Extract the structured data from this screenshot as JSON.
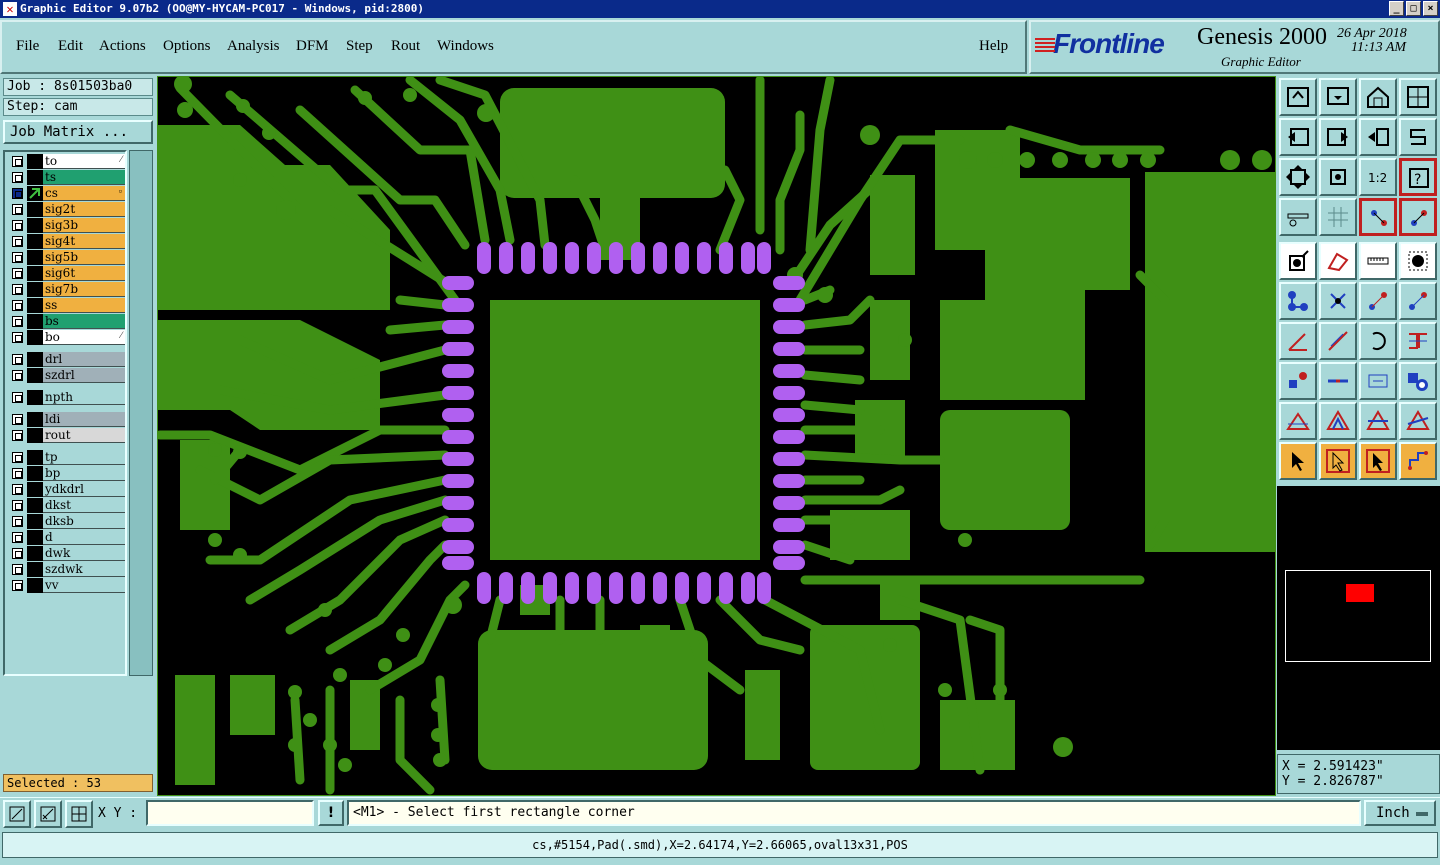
{
  "window": {
    "title": "Graphic Editor 9.07b2 (OO@MY-HYCAM-PC017 - Windows, pid:2800)",
    "controls": [
      "_",
      "□",
      "×"
    ]
  },
  "menu": {
    "items": [
      "File",
      "Edit",
      "Actions",
      "Options",
      "Analysis",
      "DFM",
      "Step",
      "Rout",
      "Windows"
    ],
    "help": "Help"
  },
  "brand": {
    "logo": "Frontline",
    "product": "Genesis 2000",
    "subtitle": "Graphic Editor",
    "date": "26 Apr 2018",
    "time": "11:13 AM"
  },
  "job": {
    "job_label": "Job : 8s01503ba0",
    "step_label": "Step: cam",
    "matrix_button": "Job Matrix ..."
  },
  "layers": [
    {
      "name": "to",
      "color": "#ffffff",
      "mark": "⁄"
    },
    {
      "name": "ts",
      "color": "#20a070",
      "mark": ""
    },
    {
      "name": "cs",
      "color": "#f0b040",
      "mark": "▫",
      "active": true
    },
    {
      "name": "sig2t",
      "color": "#f0b040",
      "mark": ""
    },
    {
      "name": "sig3b",
      "color": "#f0b040",
      "mark": ""
    },
    {
      "name": "sig4t",
      "color": "#f0b040",
      "mark": ""
    },
    {
      "name": "sig5b",
      "color": "#f0b040",
      "mark": ""
    },
    {
      "name": "sig6t",
      "color": "#f0b040",
      "mark": ""
    },
    {
      "name": "sig7b",
      "color": "#f0b040",
      "mark": ""
    },
    {
      "name": "ss",
      "color": "#f0b040",
      "mark": ""
    },
    {
      "name": "bs",
      "color": "#20a070",
      "mark": ""
    },
    {
      "name": "bo",
      "color": "#ffffff",
      "mark": "⁄"
    },
    {
      "name": "drl",
      "color": "#a0b0b8",
      "mark": ""
    },
    {
      "name": "szdrl",
      "color": "#a0b0b8",
      "mark": ""
    },
    {
      "name": "npth",
      "color": "#a8d8d8",
      "mark": ""
    },
    {
      "name": "ldi",
      "color": "#a0b0b8",
      "mark": ""
    },
    {
      "name": "rout",
      "color": "#d8d8d8",
      "mark": ""
    },
    {
      "name": "tp",
      "color": "#a8d8d8",
      "mark": ""
    },
    {
      "name": "bp",
      "color": "#a8d8d8",
      "mark": ""
    },
    {
      "name": "ydkdrl",
      "color": "#a8d8d8",
      "mark": ""
    },
    {
      "name": "dkst",
      "color": "#a8d8d8",
      "mark": ""
    },
    {
      "name": "dksb",
      "color": "#a8d8d8",
      "mark": ""
    },
    {
      "name": "d",
      "color": "#a8d8d8",
      "mark": ""
    },
    {
      "name": "dwk",
      "color": "#a8d8d8",
      "mark": ""
    },
    {
      "name": "szdwk",
      "color": "#a8d8d8",
      "mark": ""
    },
    {
      "name": "vv",
      "color": "#a8d8d8",
      "mark": ""
    }
  ],
  "selected": "Selected : 53",
  "coords": {
    "x": "X = 2.591423\"",
    "y": "Y = 2.826787\""
  },
  "toolbar_icons": [
    "zoom-home-icon",
    "zoom-out-icon",
    "home-icon",
    "snap-grid-icon",
    "pan-left-icon",
    "pan-right-icon",
    "swap-icon",
    "rout-s-icon",
    "fit-icon",
    "center-icon",
    "scale-1-2-icon",
    "help-query-icon",
    "brush-icon",
    "grid-icon",
    "layer-compare-icon",
    "layer-compare2-icon",
    "feature-select-icon",
    "edit-outline-icon",
    "ruler-icon",
    "pad-circle-icon",
    "connect-icon",
    "delete-node-icon",
    "add-arc-icon",
    "move-vertex-icon",
    "angle-icon",
    "line-icon",
    "arc-rotate-icon",
    "split-icon",
    "pad-add-icon",
    "trace-icon",
    "measure-icon",
    "multi-pad-icon",
    "triangle-icon",
    "triangle-arrow-icon",
    "polygon-icon",
    "polygon-arrow-icon",
    "pointer-icon",
    "pointer-box-icon",
    "pointer-select-icon",
    "route-icon"
  ],
  "command": {
    "xy_label": "X Y :",
    "xy_value": "",
    "prompt": "<M1> - Select first rectangle corner",
    "units": "Inch",
    "excl": "!"
  },
  "status": "cs,#5154,Pad(.smd),X=2.64174,Y=2.66065,oval13x31,POS",
  "colors": {
    "copper": "#3f9015",
    "pad_selected": "#b060f0",
    "background": "#000000",
    "chrome": "#a8d8d8"
  }
}
